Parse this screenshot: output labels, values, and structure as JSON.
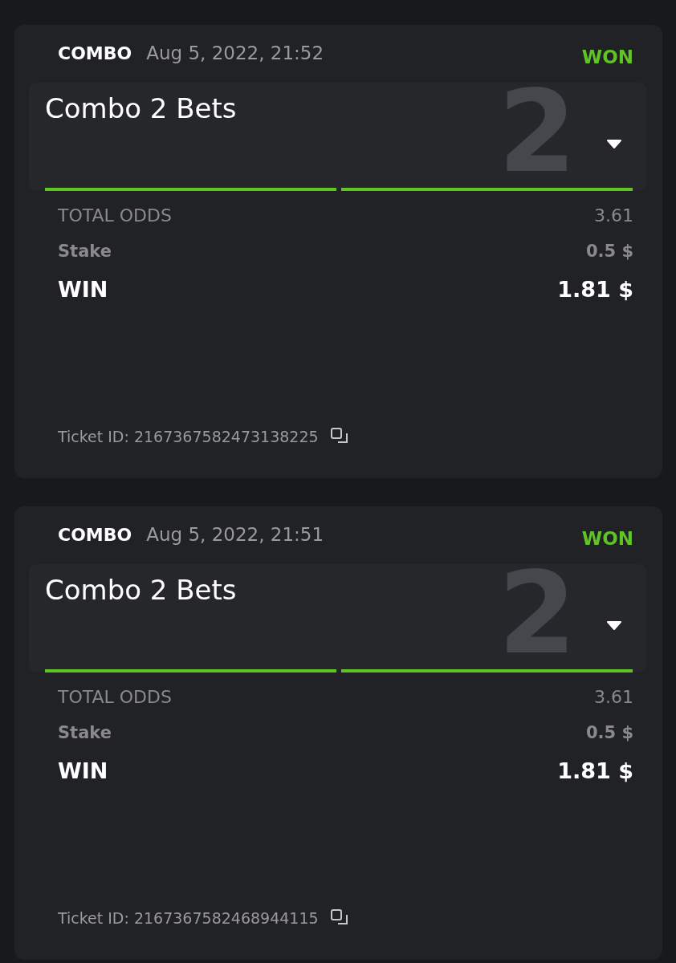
{
  "tickets": [
    {
      "type": "COMBO",
      "date": "Aug 5, 2022, 21:52",
      "status": "WON",
      "won": true,
      "title": "Combo 2 Bets",
      "bet_count": "2",
      "expanded": false,
      "legs": [
        {
          "won": true
        },
        {
          "won": true
        }
      ],
      "total_odds_label": "TOTAL ODDS",
      "total_odds": "3.61",
      "stake_label": "Stake",
      "stake": "0.5 $",
      "win_label": "WIN",
      "win": "1.81 $",
      "ticket_id": "Ticket ID: 2167367582473138225"
    },
    {
      "type": "COMBO",
      "date": "Aug 5, 2022, 21:51",
      "status": "WON",
      "won": true,
      "title": "Combo 2 Bets",
      "bet_count": "2",
      "expanded": false,
      "legs": [
        {
          "won": true
        },
        {
          "won": true
        }
      ],
      "total_odds_label": "TOTAL ODDS",
      "total_odds": "3.61",
      "stake_label": "Stake",
      "stake": "0.5 $",
      "win_label": "WIN",
      "win": "1.81 $",
      "ticket_id": "Ticket ID: 2167367582468944115"
    }
  ]
}
